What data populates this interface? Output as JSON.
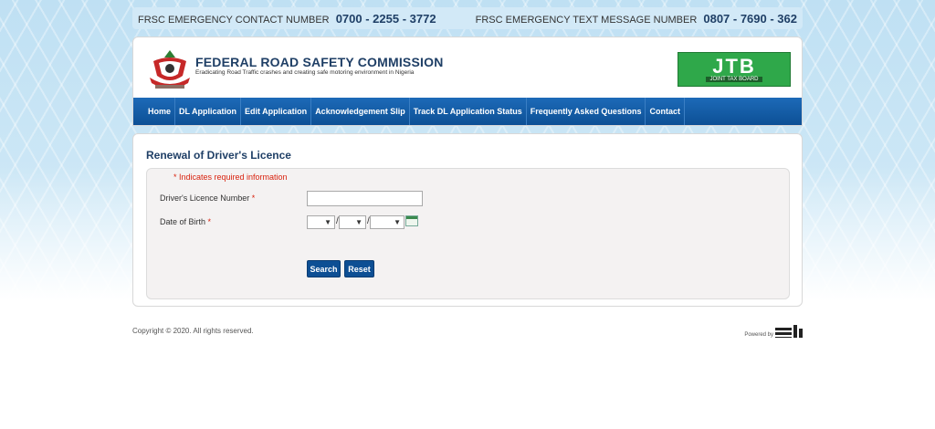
{
  "topbar": {
    "emergency_contact_label": "FRSC EMERGENCY CONTACT NUMBER",
    "emergency_contact_number": "0700 - 2255 - 3772",
    "text_message_label": "FRSC EMERGENCY TEXT MESSAGE NUMBER",
    "text_message_number": "0807 - 7690 - 362"
  },
  "header": {
    "org_name": "FEDERAL ROAD SAFETY COMMISSION",
    "tagline": "Eradicating Road Traffic crashes and creating safe motoring environment in Nigeria",
    "partner_logo_text": "JTB",
    "partner_logo_subtext": "JOINT TAX BOARD"
  },
  "nav": {
    "items": [
      {
        "label": "Home"
      },
      {
        "label": "DL Application"
      },
      {
        "label": "Edit Application"
      },
      {
        "label": "Acknowledgement Slip"
      },
      {
        "label": "Track DL Application Status"
      },
      {
        "label": "Frequently Asked Questions"
      },
      {
        "label": "Contact"
      }
    ]
  },
  "form": {
    "title": "Renewal of Driver's Licence",
    "required_note": "* Indicates required information",
    "licence_label": "Driver's Licence Number",
    "dob_label": "Date of Birth",
    "required_star": "*",
    "licence_value": "",
    "dob_day": "",
    "dob_month": "",
    "dob_year": "",
    "date_separator": "/",
    "search_label": "Search",
    "reset_label": "Reset"
  },
  "footer": {
    "copyright": "Copyright © 2020. All rights reserved.",
    "powered_by": "Powered by"
  },
  "colors": {
    "brand_blue": "#0d4f94",
    "nav_blue": "#1d6ab8",
    "required_red": "#d9230f",
    "jtb_green": "#2fa84a"
  }
}
